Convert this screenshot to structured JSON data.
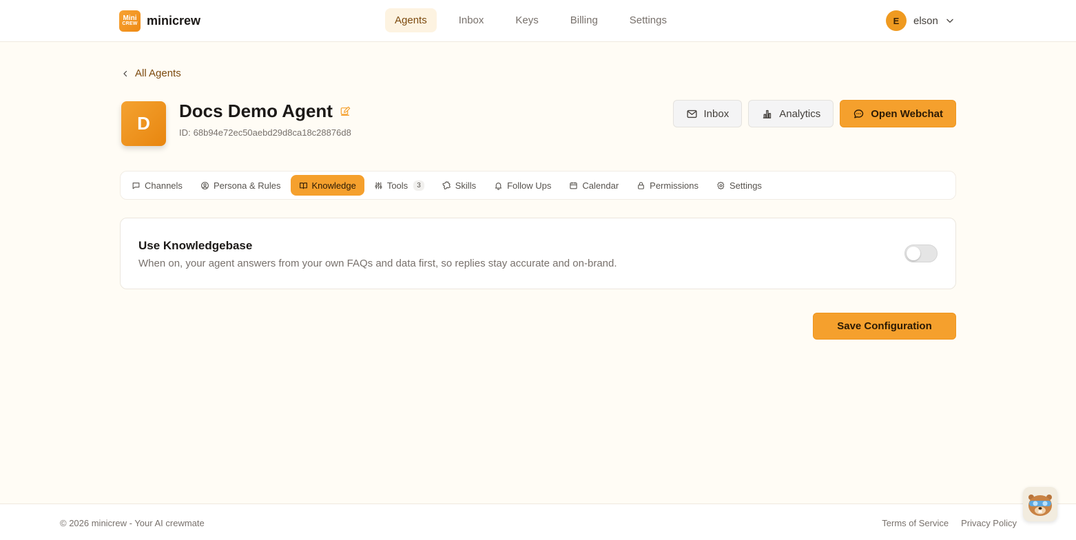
{
  "brand": {
    "logo_top": "Mini",
    "logo_bottom": "CREW",
    "name": "minicrew"
  },
  "nav": {
    "items": [
      {
        "label": "Agents"
      },
      {
        "label": "Inbox"
      },
      {
        "label": "Keys"
      },
      {
        "label": "Billing"
      },
      {
        "label": "Settings"
      }
    ],
    "active": "Agents"
  },
  "user": {
    "initial": "E",
    "name": "elson"
  },
  "back": {
    "label": "All Agents"
  },
  "agent": {
    "initial": "D",
    "name": "Docs Demo Agent",
    "id_label": "ID:",
    "id": "68b94e72ec50aebd29d8ca18c28876d8"
  },
  "actions": {
    "inbox": "Inbox",
    "analytics": "Analytics",
    "webchat": "Open Webchat"
  },
  "tabs": [
    {
      "label": "Channels"
    },
    {
      "label": "Persona & Rules"
    },
    {
      "label": "Knowledge"
    },
    {
      "label": "Tools",
      "badge": "3"
    },
    {
      "label": "Skills"
    },
    {
      "label": "Follow Ups"
    },
    {
      "label": "Calendar"
    },
    {
      "label": "Permissions"
    },
    {
      "label": "Settings"
    }
  ],
  "active_tab": "Knowledge",
  "knowledge": {
    "title": "Use Knowledgebase",
    "description": "When on, your agent answers from your own FAQs and data first, so replies stay accurate and on-brand.",
    "enabled": false
  },
  "save_label": "Save Configuration",
  "footer": {
    "copyright": "© 2026 minicrew - Your AI crewmate",
    "terms": "Terms of Service",
    "privacy": "Privacy Policy"
  },
  "colors": {
    "accent": "#f5a02d",
    "background": "#fffcf5",
    "text": "#1c1917",
    "muted": "#78716c"
  }
}
